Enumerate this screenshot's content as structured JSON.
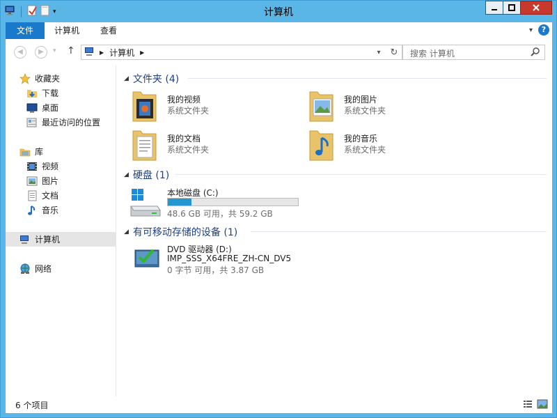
{
  "window": {
    "title": "计算机",
    "buttons": {
      "minimize": "—",
      "maximize": "☐",
      "close": "✕"
    }
  },
  "ribbon": {
    "file_tab": "文件",
    "tabs": [
      "计算机",
      "查看"
    ]
  },
  "address": {
    "path_label": "计算机",
    "search_placeholder": "搜索 计算机"
  },
  "nav": {
    "favorites": "收藏夹",
    "favorites_items": [
      "下载",
      "桌面",
      "最近访问的位置"
    ],
    "libraries": "库",
    "library_items": [
      "视频",
      "图片",
      "文档",
      "音乐"
    ],
    "computer": "计算机",
    "network": "网络"
  },
  "sections": {
    "folders": {
      "title": "文件夹 (4)",
      "items": [
        {
          "name": "我的视频",
          "sub": "系统文件夹"
        },
        {
          "name": "我的图片",
          "sub": "系统文件夹"
        },
        {
          "name": "我的文档",
          "sub": "系统文件夹"
        },
        {
          "name": "我的音乐",
          "sub": "系统文件夹"
        }
      ]
    },
    "drives": {
      "title": "硬盘 (1)",
      "items": [
        {
          "name": "本地磁盘 (C:)",
          "sub": "48.6 GB 可用，共 59.2 GB",
          "used_fraction": 0.18
        }
      ]
    },
    "removable": {
      "title": "有可移动存储的设备 (1)",
      "items": [
        {
          "name": "DVD 驱动器 (D:)",
          "label": "IMP_SSS_X64FRE_ZH-CN_DV5",
          "sub": "0 字节 可用，共 3.87 GB"
        }
      ]
    }
  },
  "status": {
    "item_count": "6 个项目"
  },
  "colors": {
    "accent": "#1979ca",
    "chrome": "#5ab6e6",
    "drive_bar": "#2696d0",
    "section_title": "#1e3f8a"
  }
}
